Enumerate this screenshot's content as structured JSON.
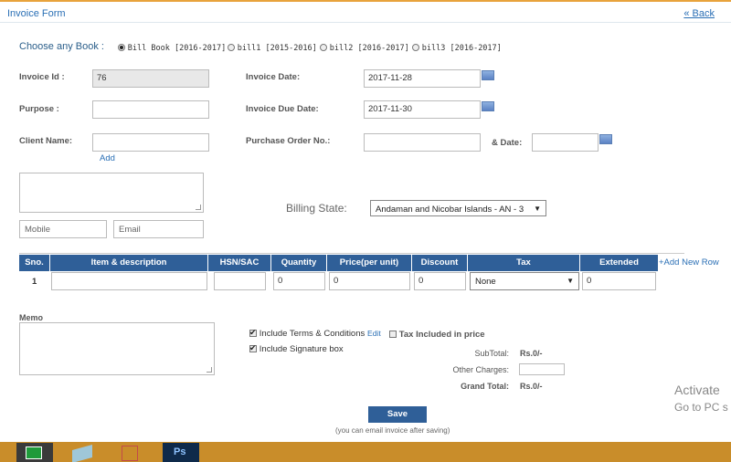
{
  "header": {
    "title": "Invoice Form",
    "back_link": "« Back"
  },
  "books": {
    "label": "Choose any Book :",
    "options": [
      {
        "label": "Bill Book [2016-2017]",
        "selected": true
      },
      {
        "label": "bill1 [2015-2016]",
        "selected": false
      },
      {
        "label": "bill2 [2016-2017]",
        "selected": false
      },
      {
        "label": "bill3 [2016-2017]",
        "selected": false
      }
    ]
  },
  "form": {
    "invoice_id_label": "Invoice Id :",
    "invoice_id_value": "76",
    "invoice_date_label": "Invoice Date:",
    "invoice_date_value": "2017-11-28",
    "purpose_label": "Purpose :",
    "purpose_value": "",
    "due_date_label": "Invoice Due Date:",
    "due_date_value": "2017-11-30",
    "client_label": "Client Name:",
    "client_value": "",
    "add_link": "Add",
    "po_label": "Purchase Order No.:",
    "po_value": "",
    "po_date_label": "& Date:",
    "po_date_value": "",
    "mobile_placeholder": "Mobile",
    "email_placeholder": "Email",
    "billing_state_label": "Billing State:",
    "billing_state_value": "Andaman and Nicobar Islands - AN - 3"
  },
  "table": {
    "headers": [
      "Sno.",
      "Item & description",
      "HSN/SAC",
      "Quantity",
      "Price(per unit)",
      "Discount",
      "Tax",
      "Extended"
    ],
    "add_row": "+Add New Row",
    "rows": [
      {
        "sno": "1",
        "item": "",
        "hsn": "",
        "quantity": "0",
        "price": "0",
        "discount": "0",
        "tax": "None",
        "extended": "0"
      }
    ]
  },
  "memo": {
    "label": "Memo",
    "include_terms": "Include Terms & Conditions",
    "edit_link": "Edit",
    "tax_included": "Tax Included in price",
    "include_signature": "Include Signature box"
  },
  "totals": {
    "subtotal_label": "SubTotal:",
    "subtotal_value": "Rs.0/-",
    "other_label": "Other Charges:",
    "other_value": "",
    "grand_label": "Grand Total:",
    "grand_value": "Rs.0/-"
  },
  "actions": {
    "save": "Save",
    "hint": "(you can email invoice after saving)"
  },
  "watermark": {
    "line1": "Activate",
    "line2": "Go to PC s"
  },
  "taskbar": {
    "apps": [
      "store-icon",
      "notes-icon",
      "paint-icon",
      "photoshop-icon"
    ],
    "ps_label": "Ps"
  },
  "colors": {
    "accent": "#2f5f98",
    "link": "#2a6fb5",
    "taskbar": "#c98d2a"
  }
}
